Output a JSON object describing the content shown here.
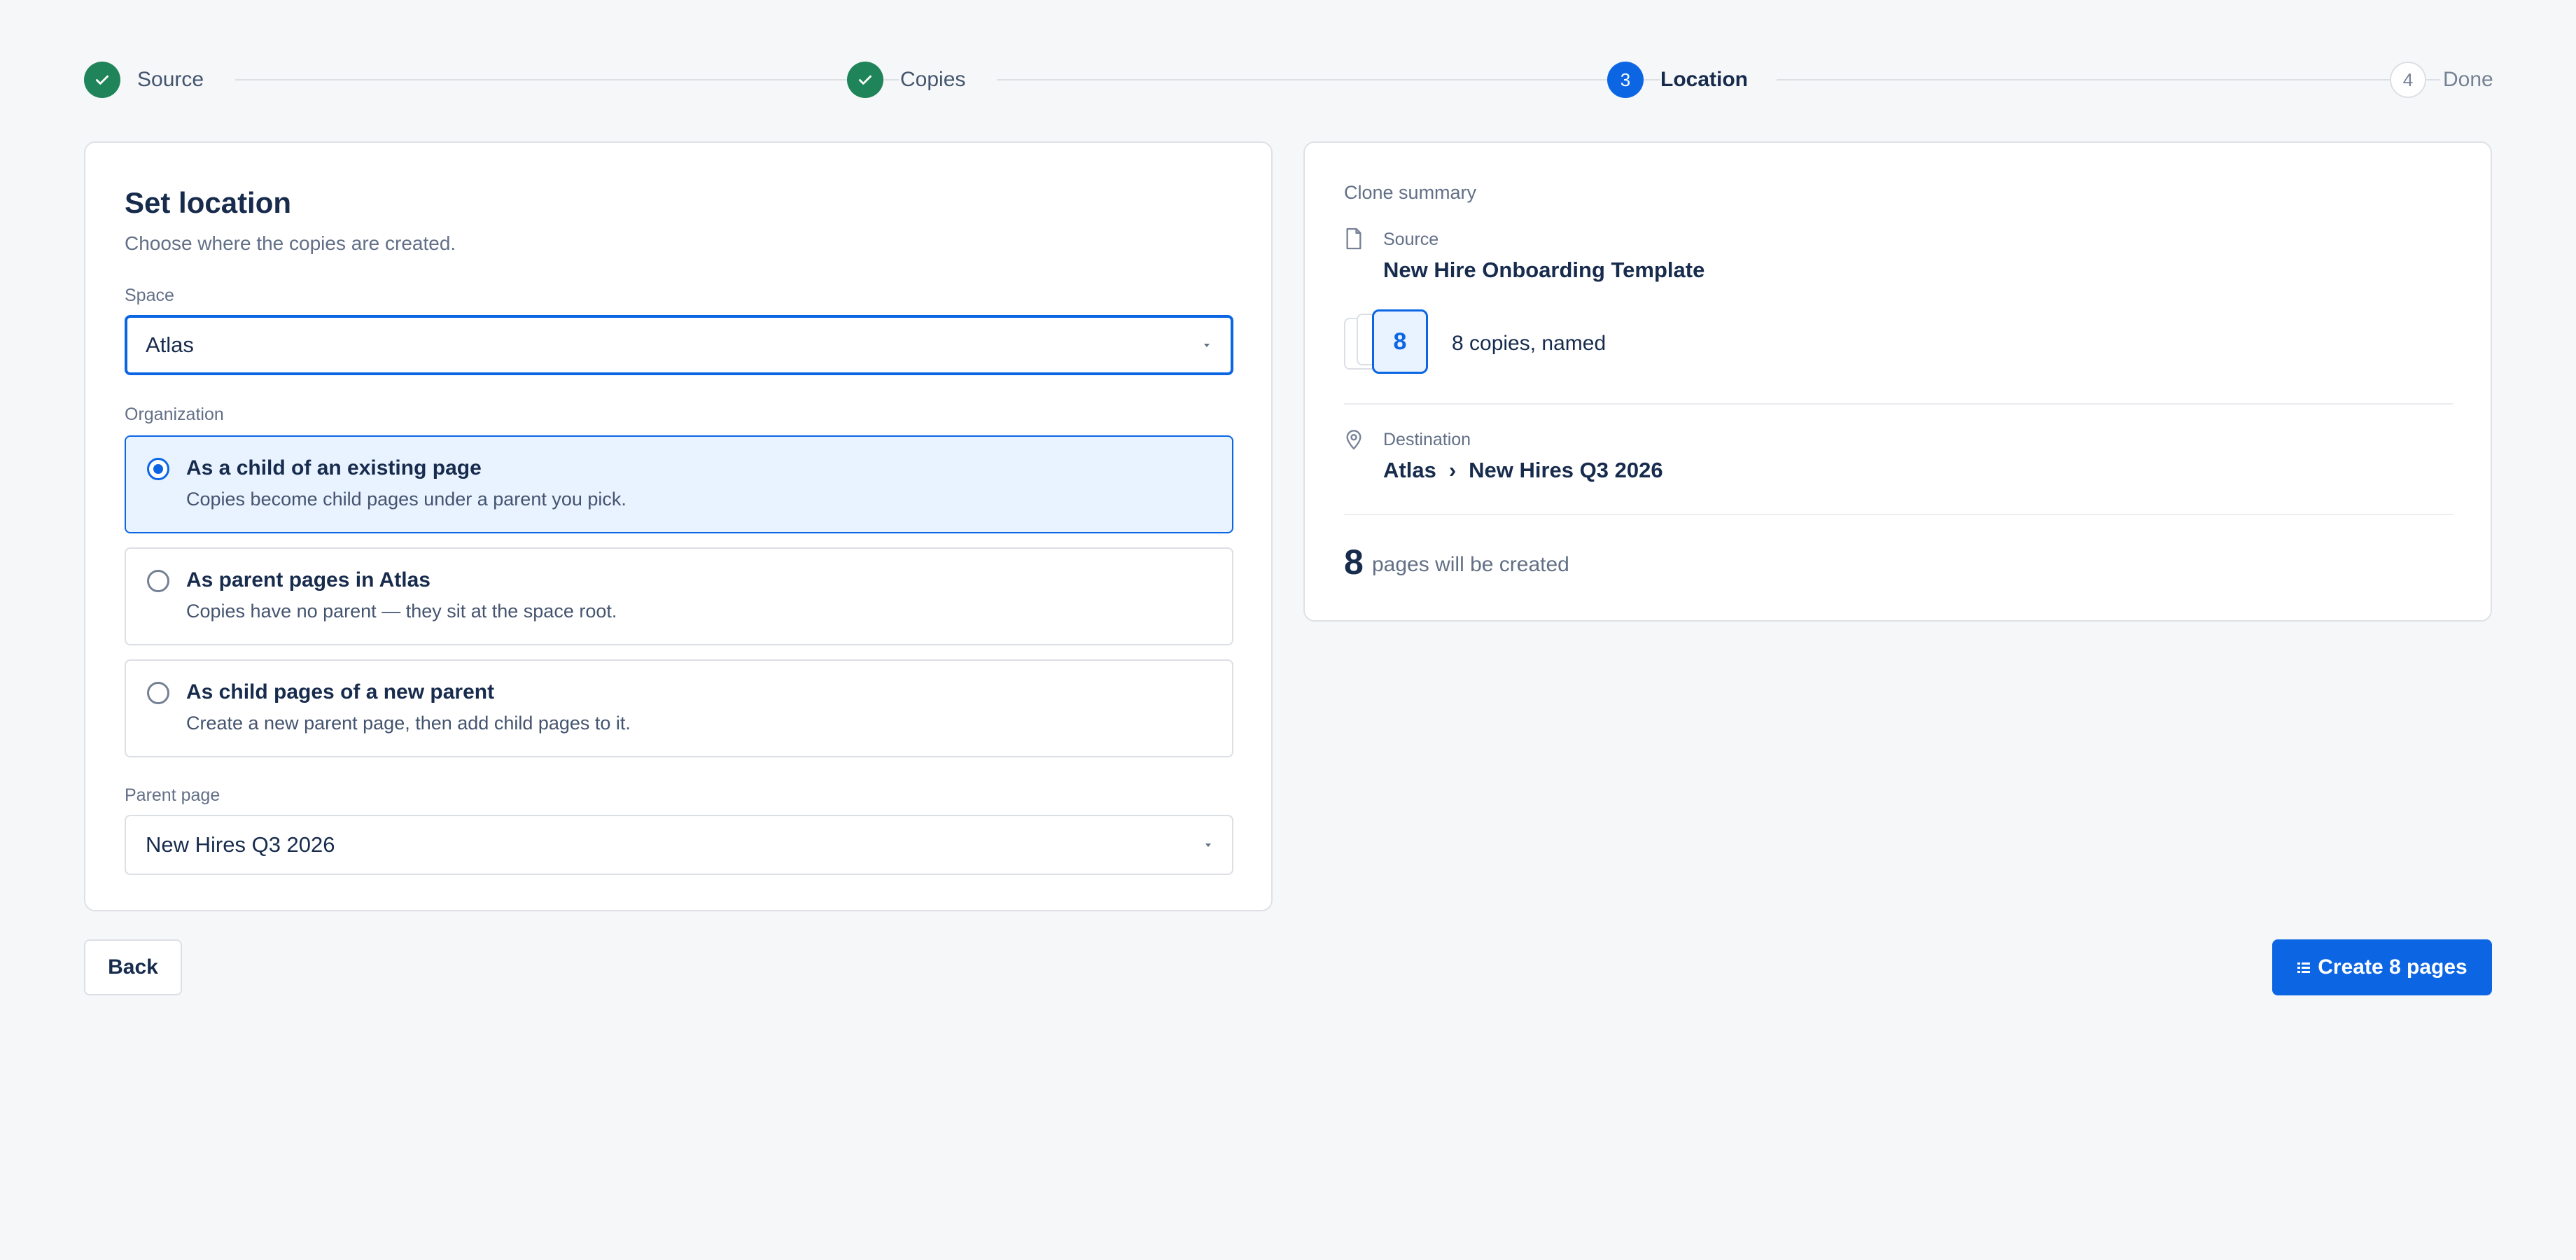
{
  "stepper": {
    "steps": [
      {
        "label": "Source",
        "state": "done",
        "number": ""
      },
      {
        "label": "Copies",
        "state": "done",
        "number": ""
      },
      {
        "label": "Location",
        "state": "current",
        "number": "3"
      },
      {
        "label": "Done",
        "state": "todo",
        "number": "4"
      }
    ]
  },
  "location": {
    "title": "Set location",
    "subtitle": "Choose where the copies are created.",
    "space_label": "Space",
    "space_value": "Atlas",
    "organization_label": "Organization",
    "options": [
      {
        "title": "As a child of an existing page",
        "description": "Copies become child pages under a parent you pick.",
        "selected": true
      },
      {
        "title": "As parent pages in Atlas",
        "description": "Copies have no parent — they sit at the space root.",
        "selected": false
      },
      {
        "title": "As child pages of a new parent",
        "description": "Create a new parent page, then add child pages to it.",
        "selected": false
      }
    ],
    "parent_label": "Parent page",
    "parent_value": "New Hires Q3 2026"
  },
  "summary": {
    "header": "Clone summary",
    "source_label": "Source",
    "source_value": "New Hire Onboarding Template",
    "copies_count": "8",
    "copies_text": "8 copies, named",
    "destination_label": "Destination",
    "destination_space": "Atlas",
    "destination_separator": "›",
    "destination_page": "New Hires Q3 2026",
    "total_count": "8",
    "total_text": "pages will be created"
  },
  "footer": {
    "back_label": "Back",
    "create_label": "Create 8 pages"
  },
  "colors": {
    "accent": "#0c66e4",
    "success": "#1f845a",
    "selected_bg": "#e9f2ff"
  },
  "icons": {
    "done_step": "check-icon",
    "source": "document-icon",
    "destination": "location-pin-icon",
    "create": "grid-icon"
  }
}
